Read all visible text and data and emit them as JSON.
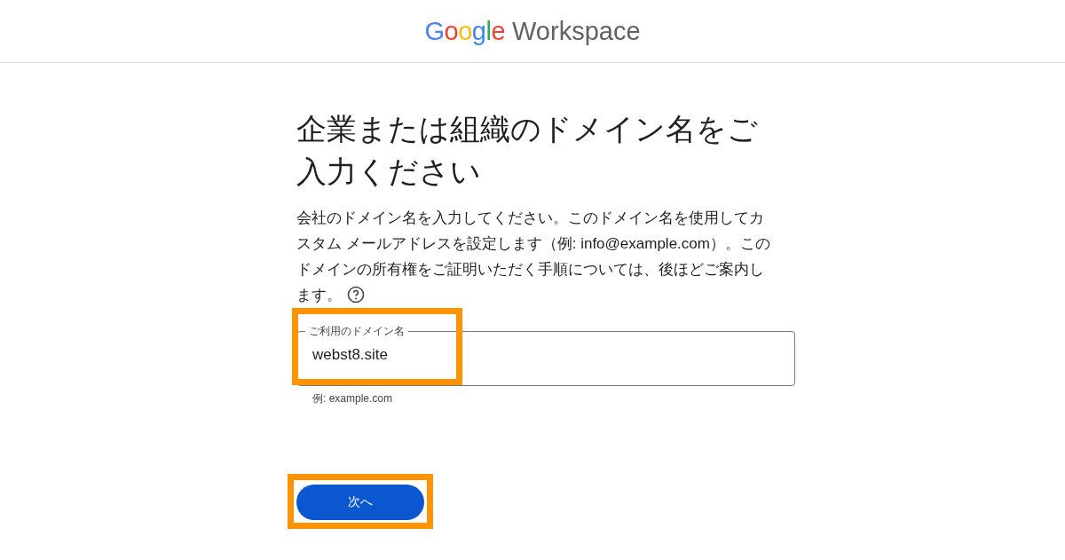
{
  "header": {
    "logo": {
      "brand": "Google",
      "product": "Workspace"
    }
  },
  "title": "企業または組織のドメイン名をご入力ください",
  "description": "会社のドメイン名を入力してください。このドメイン名を使用してカスタム メールアドレスを設定します（例: info@example.com）。このドメインの所有権をご証明いただく手順については、後ほどご案内します。",
  "domain_field": {
    "label": "ご利用のドメイン名",
    "value": "webst8.site",
    "helper": "例: example.com",
    "highlighted": true
  },
  "next_button": {
    "label": "次へ",
    "highlighted": true
  }
}
